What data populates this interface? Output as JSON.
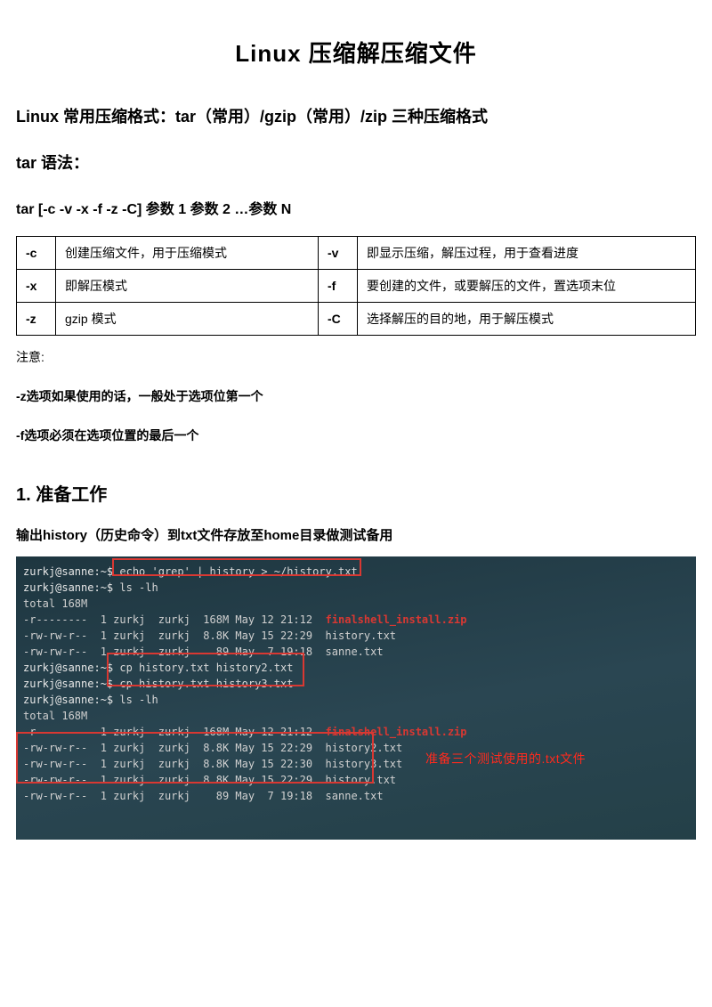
{
  "title": "Linux 压缩解压缩文件",
  "intro": "Linux 常用压缩格式：tar（常用）/gzip（常用）/zip 三种压缩格式",
  "tar_header": "tar 语法：",
  "tar_syntax": "tar [-c -v -x -f -z -C]  参数 1  参数 2 …参数 N",
  "table": {
    "rows": [
      {
        "f1": "-c",
        "d1": "创建压缩文件，用于压缩模式",
        "f2": "-v",
        "d2": "即显示压缩，解压过程，用于查看进度"
      },
      {
        "f1": "-x",
        "d1": "即解压模式",
        "f2": "-f",
        "d2": "要创建的文件，或要解压的文件，置选项末位"
      },
      {
        "f1": "-z",
        "d1": "gzip 模式",
        "f2": "-C",
        "d2": "选择解压的目的地，用于解压模式"
      }
    ]
  },
  "notes": {
    "title": "注意:",
    "n1": "-z选项如果使用的话，一般处于选项位第一个",
    "n2": "-f选项必须在选项位置的最后一个"
  },
  "section1_h": "1. 准备工作",
  "section1_sub": "输出history（历史命令）到txt文件存放至home目录做测试备用",
  "term": {
    "l0p": "zurkj@sanne:~$ ",
    "l0c": "echo 'grep' | history > ~/history.txt",
    "l1p": "zurkj@sanne:~$ ",
    "l1c": "ls -lh",
    "l2": "total 168M",
    "l3a": "-r--------  1 zurkj  zurkj  168M May 12 21:12  ",
    "l3b": "finalshell_install.zip",
    "l4": "-rw-rw-r--  1 zurkj  zurkj  8.8K May 15 22:29  history.txt",
    "l5": "-rw-rw-r--  1 zurkj  zurkj    89 May  7 19:18  sanne.txt",
    "l6p": "zurkj@sanne:~$ ",
    "l6c": "cp history.txt history2.txt",
    "l7p": "zurkj@sanne:~$ ",
    "l7c": "cp history.txt history3.txt",
    "l8p": "zurkj@sanne:~$ ",
    "l8c": "ls -lh",
    "l9": "total 168M",
    "l10a": "-r--------  1 zurkj  zurkj  168M May 12 21:12  ",
    "l10b": "finalshell_install.zip",
    "l11": "-rw-rw-r--  1 zurkj  zurkj  8.8K May 15 22:29  history2.txt",
    "l12": "-rw-rw-r--  1 zurkj  zurkj  8.8K May 15 22:30  history3.txt",
    "l13": "-rw-rw-r--  1 zurkj  zurkj  8.8K May 15 22:29  history.txt",
    "l14": "-rw-rw-r--  1 zurkj  zurkj    89 May  7 19:18  sanne.txt"
  },
  "annotation": "准备三个测试使用的.txt文件"
}
